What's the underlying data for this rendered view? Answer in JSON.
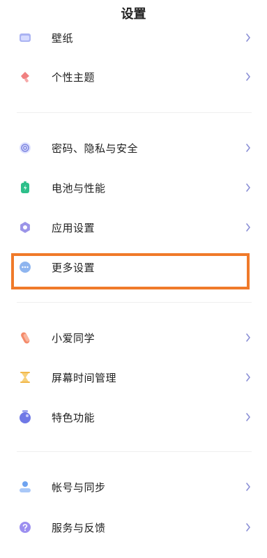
{
  "header": {
    "title": "设置"
  },
  "group1": [
    {
      "label": "壁纸",
      "icon": "wallpaper-icon"
    },
    {
      "label": "个性主题",
      "icon": "theme-brush-icon"
    }
  ],
  "group2": [
    {
      "label": "密码、隐私与安全",
      "icon": "fingerprint-icon"
    },
    {
      "label": "电池与性能",
      "icon": "battery-icon"
    },
    {
      "label": "应用设置",
      "icon": "gear-icon"
    },
    {
      "label": "更多设置",
      "icon": "more-dots-icon"
    }
  ],
  "group3": [
    {
      "label": "小爱同学",
      "icon": "xiaoai-icon"
    },
    {
      "label": "屏幕时间管理",
      "icon": "hourglass-icon"
    },
    {
      "label": "特色功能",
      "icon": "feature-jar-icon"
    }
  ],
  "group4": [
    {
      "label": "帐号与同步",
      "icon": "account-icon"
    },
    {
      "label": "服务与反馈",
      "icon": "help-icon"
    }
  ],
  "colors": {
    "highlight": "#f07a2a",
    "chevron": "#8a8fd6"
  }
}
